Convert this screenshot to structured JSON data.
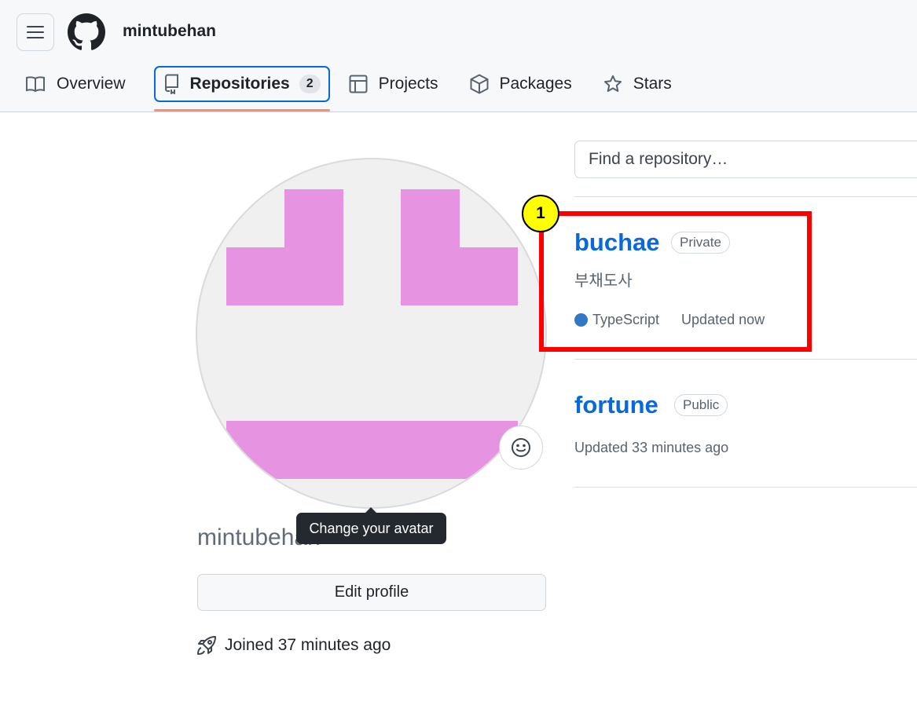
{
  "header": {
    "username": "mintubehan",
    "tabs": [
      {
        "label": "Overview",
        "icon": "book-icon"
      },
      {
        "label": "Repositories",
        "icon": "repo-icon",
        "count": "2",
        "active": true
      },
      {
        "label": "Projects",
        "icon": "table-icon"
      },
      {
        "label": "Packages",
        "icon": "package-icon"
      },
      {
        "label": "Stars",
        "icon": "star-icon"
      }
    ]
  },
  "profile": {
    "username": "mintubehan",
    "avatar_tooltip": "Change your avatar",
    "edit_profile_label": "Edit profile",
    "joined": "Joined 37 minutes ago",
    "avatar_color": "#e693e2"
  },
  "search": {
    "placeholder": "Find a repository…"
  },
  "repos": [
    {
      "name": "buchae",
      "visibility": "Private",
      "description": "부채도사",
      "language": "TypeScript",
      "language_color": "#3178c6",
      "updated": "Updated now"
    },
    {
      "name": "fortune",
      "visibility": "Public",
      "updated": "Updated 33 minutes ago"
    }
  ],
  "annotation": {
    "marker": "1"
  },
  "colors": {
    "accent": "#0969da",
    "tab_underline": "#fd8c73",
    "highlight": "#ff0000",
    "marker": "#ffff00"
  }
}
